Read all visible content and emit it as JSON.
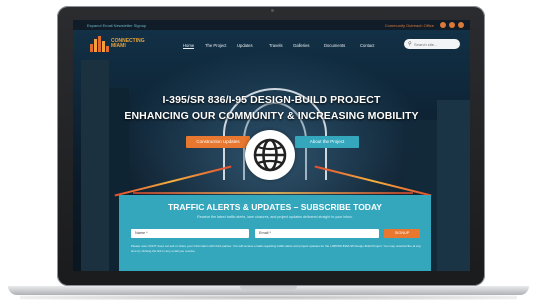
{
  "topbar": {
    "left_text": "Espanol   Email Newsletter Signup",
    "right_text": "Community Outreach Office"
  },
  "nav": {
    "logo_text": "CONNECTING MIAMI",
    "items": [
      "Home",
      "The Project",
      "Updates",
      "Travels",
      "Galleries",
      "Documents",
      "Contact"
    ],
    "search_placeholder": "Search site..."
  },
  "hero": {
    "title_line1": "I-395/SR 836/I-95 DESIGN-BUILD PROJECT",
    "title_line2": "ENHANCING OUR COMMUNITY & INCREASING MOBILITY",
    "button_left": "Construction Updates",
    "button_right": "About the Project"
  },
  "overlay": {
    "icon": "globe-icon"
  },
  "subscribe": {
    "heading": "TRAFFIC ALERTS & UPDATES – SUBSCRIBE TODAY",
    "text": "Receive the latest traffic alerts, lane closures, and project updates delivered straight to your inbox.",
    "name_label": "Name *",
    "email_label": "Email *",
    "button": "SIGNUP",
    "fine_print": "Please note: FDOT does not sell or share your information with third parties. You will receive emails regarding traffic alerts and project updates for the I-395/SR 836/I-95 Design-Build Project. You may unsubscribe at any time by clicking the link in any email you receive."
  },
  "colors": {
    "accent": "#e8782f",
    "teal": "#35a7bd",
    "nav_bg": "#101c28"
  }
}
